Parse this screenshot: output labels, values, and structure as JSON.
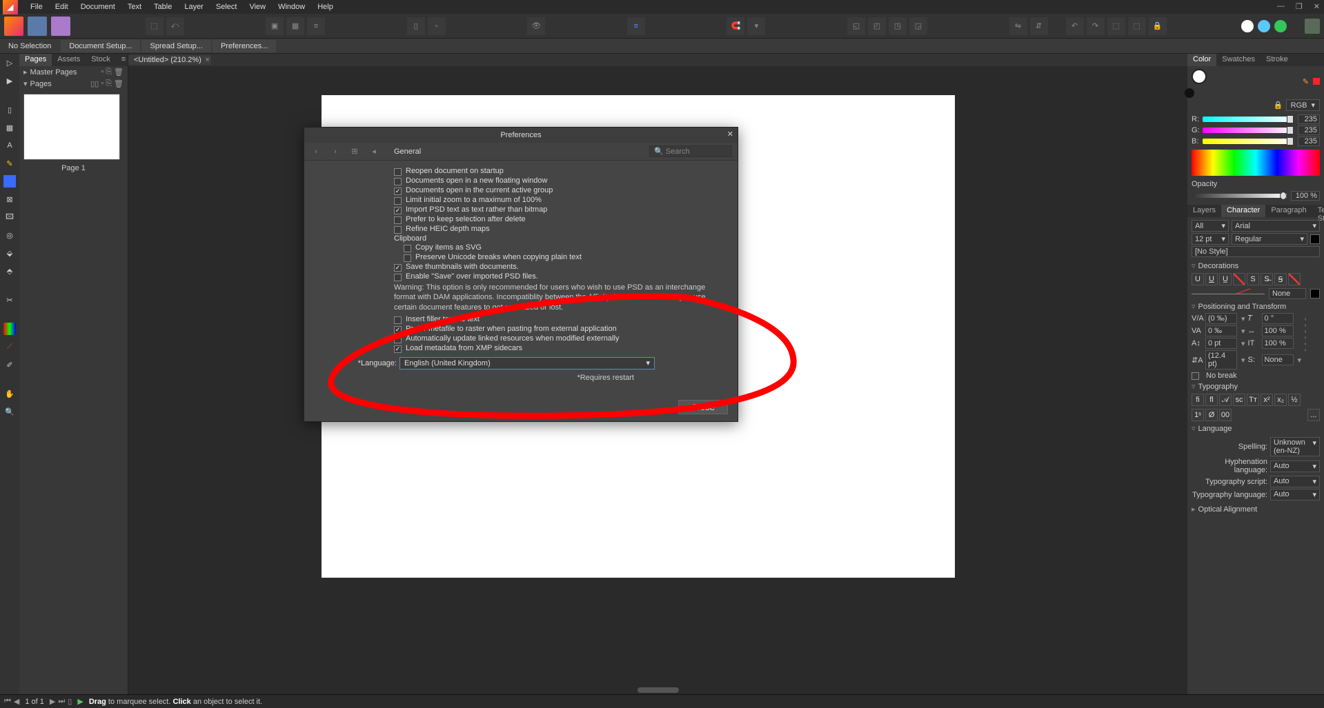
{
  "menu": [
    "File",
    "Edit",
    "Document",
    "Text",
    "Table",
    "Layer",
    "Select",
    "View",
    "Window",
    "Help"
  ],
  "contextbar": {
    "noselection": "No Selection",
    "items": [
      "Document Setup...",
      "Spread Setup...",
      "Preferences..."
    ]
  },
  "pagesPanel": {
    "tabs": [
      "Pages",
      "Assets",
      "Stock"
    ],
    "master": "Master Pages",
    "pages": "Pages",
    "pageLabel": "Page 1"
  },
  "docTab": {
    "title": "<Untitled> (210.2%)"
  },
  "dialog": {
    "title": "Preferences",
    "crumb": "General",
    "searchPlaceholder": "Search",
    "options": [
      {
        "label": "Reopen document on startup",
        "checked": false,
        "sub": false
      },
      {
        "label": "Documents open in a new floating window",
        "checked": false,
        "sub": false
      },
      {
        "label": "Documents open in the current active group",
        "checked": true,
        "sub": false
      },
      {
        "label": "Limit initial zoom to a maximum of 100%",
        "checked": false,
        "sub": false
      },
      {
        "label": "Import PSD text as text rather than bitmap",
        "checked": true,
        "sub": false
      },
      {
        "label": "Prefer to keep selection after delete",
        "checked": false,
        "sub": false
      },
      {
        "label": "Refine HEIC depth maps",
        "checked": false,
        "sub": false
      }
    ],
    "clipboardHeader": "Clipboard",
    "clipboard": [
      {
        "label": "Copy items as SVG",
        "checked": false,
        "sub": true
      },
      {
        "label": "Preserve Unicode breaks when copying plain text",
        "checked": false,
        "sub": true
      }
    ],
    "afterClipboard": [
      {
        "label": "Save thumbnails with documents.",
        "checked": true,
        "sub": false
      },
      {
        "label": "Enable \"Save\" over imported PSD files.",
        "checked": false,
        "sub": false
      }
    ],
    "warning": "Warning: This option is only recommended for users who wish to use PSD as an interchange format with DAM applications. Incompatiblity between the Affinity format and PSD may cause certain document features to get rasterized or lost.",
    "afterWarning": [
      {
        "label": "Insert filler text as text",
        "checked": false,
        "sub": false
      },
      {
        "label": "Prefer metafile to raster when pasting from external application",
        "checked": true,
        "sub": false
      },
      {
        "label": "Automatically update linked resources when modified externally",
        "checked": false,
        "sub": false
      },
      {
        "label": "Load metadata from XMP sidecars",
        "checked": true,
        "sub": false
      }
    ],
    "languageLabel": "*Language:",
    "languageValue": "English (United Kingdom)",
    "requires": "*Requires restart",
    "close": "Close"
  },
  "rightPanel": {
    "colorTabs": [
      "Color",
      "Swatches",
      "Stroke"
    ],
    "mode": "RGB",
    "rgb": {
      "R": "235",
      "G": "235",
      "B": "235"
    },
    "opacityLabel": "Opacity",
    "opacity": "100 %",
    "charTabs": [
      "Layers",
      "Character",
      "Paragraph",
      "Text Styles"
    ],
    "filter": "All",
    "font": "Arial",
    "size": "12 pt",
    "weight": "Regular",
    "style": "[No Style]",
    "decorationsHeader": "Decorations",
    "decoNone": "None",
    "posHeader": "Positioning and Transform",
    "pos": {
      "vak": "(0 ‰)",
      "va": "0 ‰",
      "baseline": "0 pt",
      "leading": "(12.4 pt)",
      "rotate": "0 °",
      "scaleH": "100 %",
      "scaleV": "100 %",
      "shear": "None"
    },
    "nobreak": "No break",
    "typoHeader": "Typography",
    "typoMore": "...",
    "langHeader": "Language",
    "lang": {
      "spellingL": "Spelling:",
      "spellingV": "Unknown (en-NZ)",
      "hyphL": "Hyphenation language:",
      "hyphV": "Auto",
      "scriptL": "Typography script:",
      "scriptV": "Auto",
      "typolL": "Typography language:",
      "typolV": "Auto"
    },
    "optAlign": "Optical Alignment"
  },
  "status": {
    "pages": "1 of 1",
    "hintDrag": "Drag",
    "hintDragRest": " to marquee select. ",
    "hintClick": "Click",
    "hintClickRest": " an object to select it."
  }
}
